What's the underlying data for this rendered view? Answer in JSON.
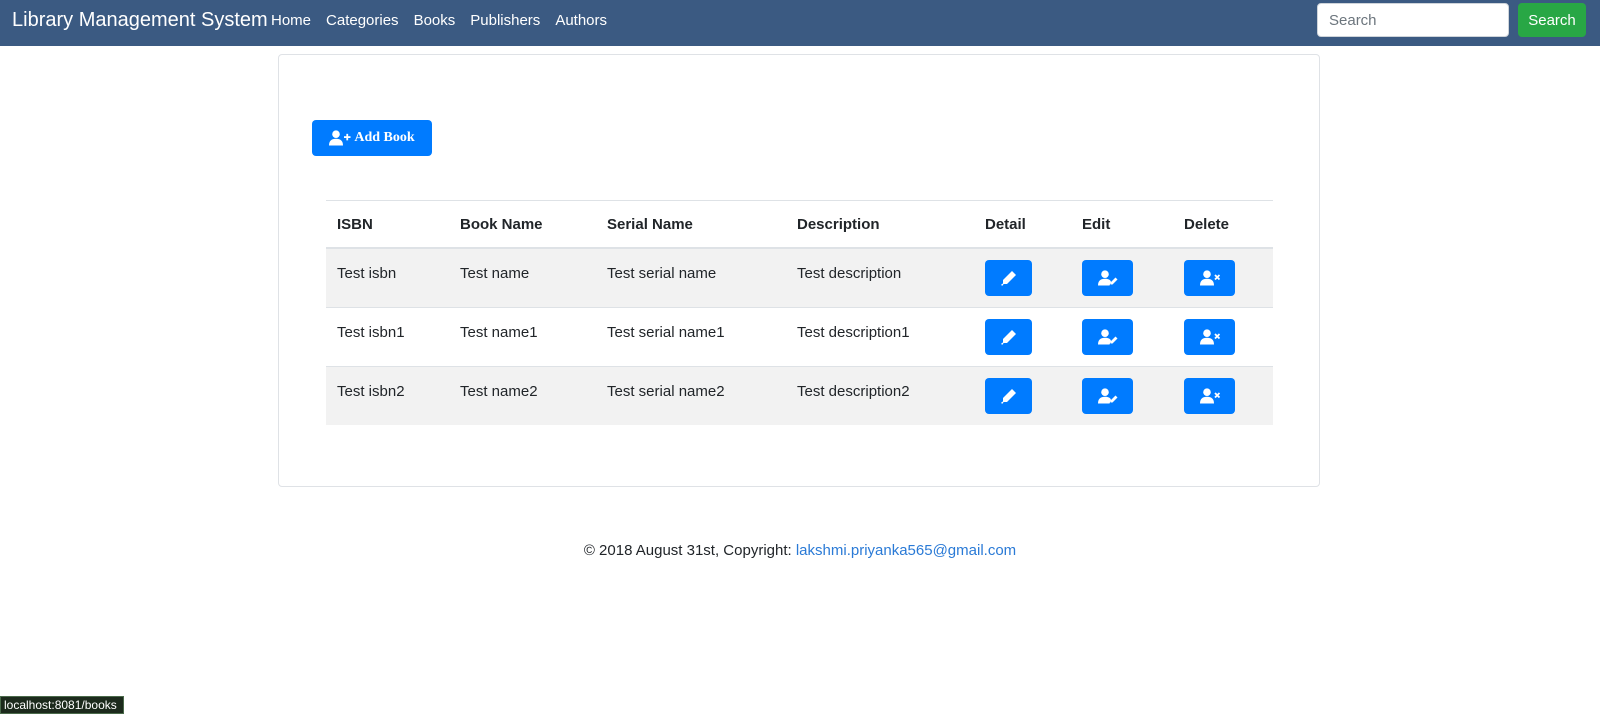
{
  "navbar": {
    "brand": "Library Management System",
    "links": [
      "Home",
      "Categories",
      "Books",
      "Publishers",
      "Authors"
    ],
    "search_placeholder": "Search",
    "search_button": "Search"
  },
  "main": {
    "add_button_label": "Add Book",
    "table": {
      "headers": [
        "ISBN",
        "Book Name",
        "Serial Name",
        "Description",
        "Detail",
        "Edit",
        "Delete"
      ],
      "rows": [
        [
          "Test isbn",
          "Test name",
          "Test serial name",
          "Test description"
        ],
        [
          "Test isbn1",
          "Test name1",
          "Test serial name1",
          "Test description1"
        ],
        [
          "Test isbn2",
          "Test name2",
          "Test serial name2",
          "Test description2"
        ]
      ],
      "row_icons": [
        "pencil-icon",
        "user-edit-icon",
        "user-delete-icon"
      ]
    }
  },
  "footer": {
    "text": "© 2018 August 31st, Copyright: ",
    "email": "lakshmi.priyanka565@gmail.com"
  },
  "status_bar": {
    "url": "localhost:8081/books"
  },
  "colors": {
    "navbar": "#3b5a82",
    "primary": "#007bff",
    "success": "#28a745",
    "link": "#2a7ad6",
    "striped_row": "#f2f2f2"
  }
}
